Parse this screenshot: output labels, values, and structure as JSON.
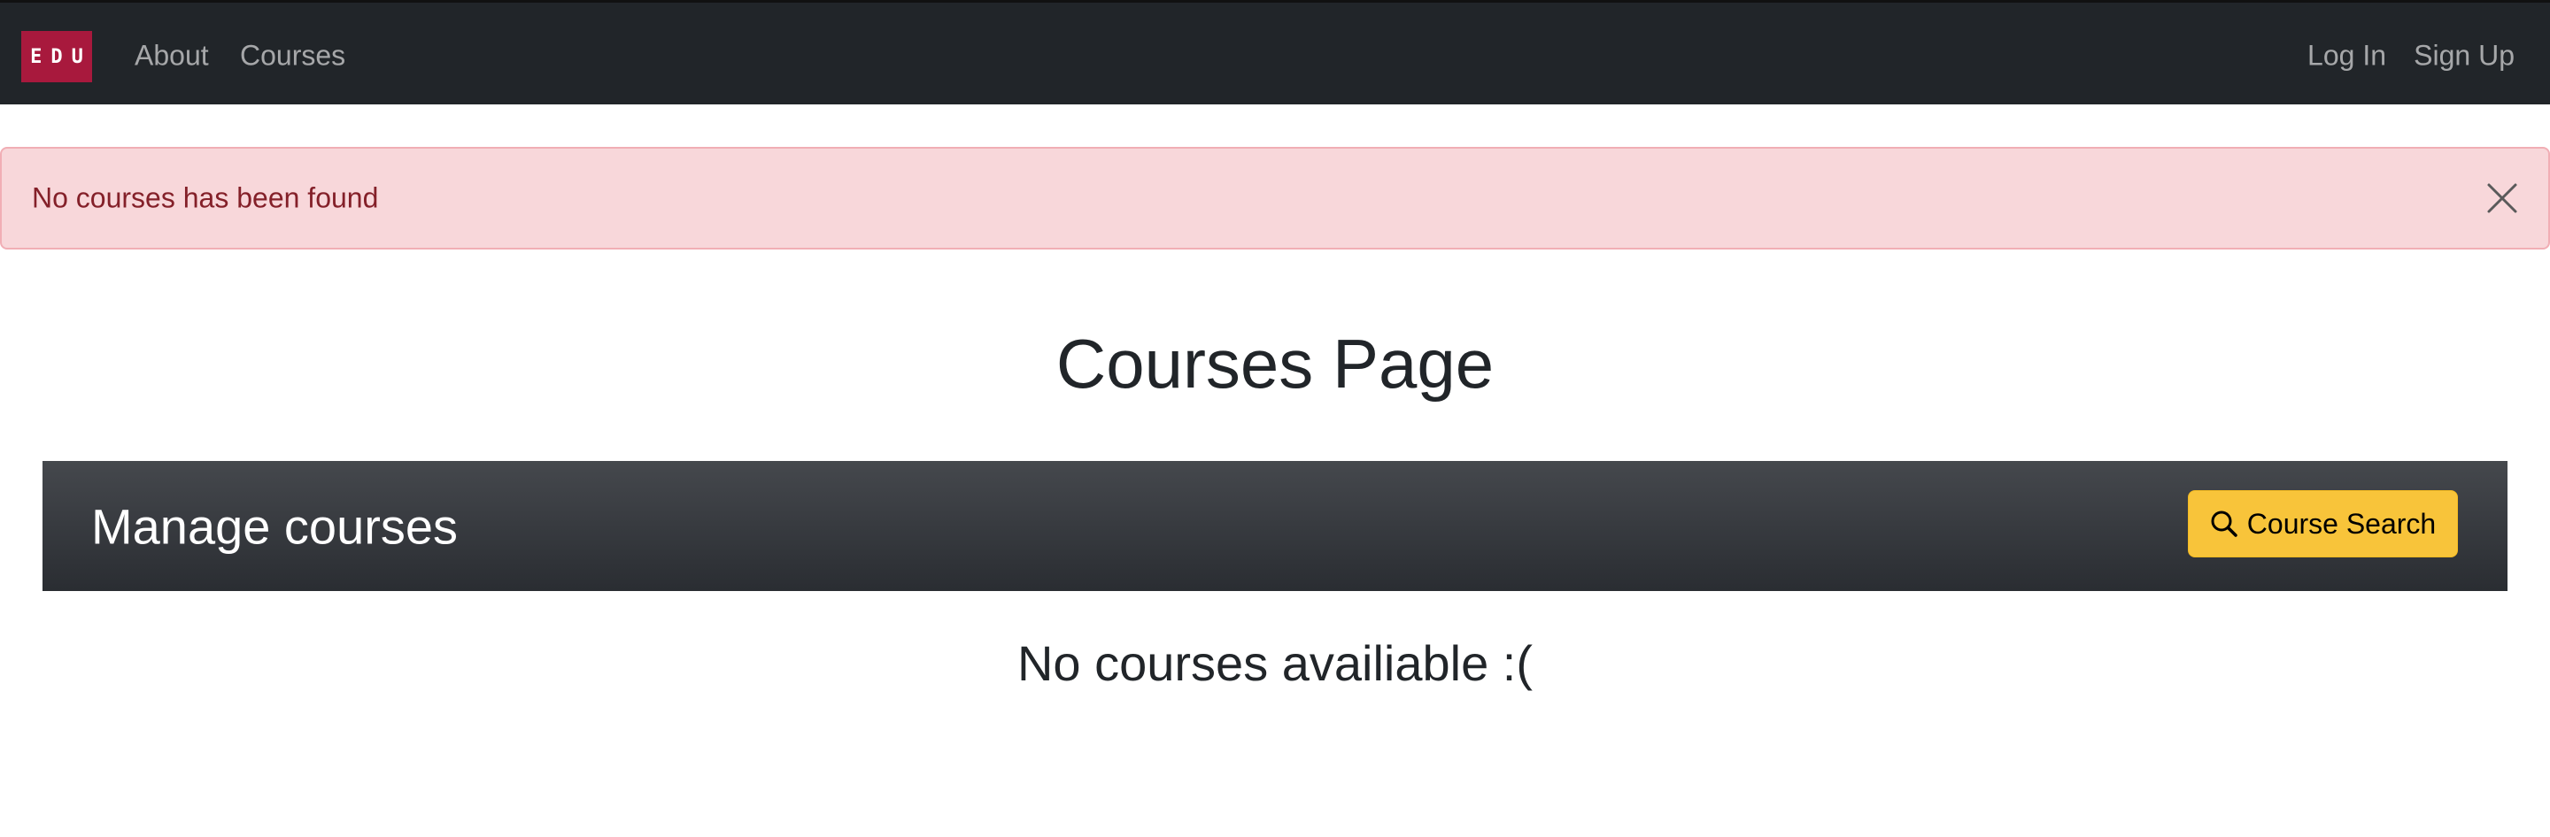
{
  "navbar": {
    "brand": "EDU",
    "links": [
      {
        "label": "About"
      },
      {
        "label": "Courses"
      }
    ],
    "auth": {
      "login_label": "Log In",
      "signup_label": "Sign Up"
    }
  },
  "alert": {
    "message": "No courses has been found",
    "close_icon": "close-icon"
  },
  "page": {
    "title": "Courses Page"
  },
  "manage": {
    "title": "Manage courses",
    "search_button_label": "Course Search",
    "search_icon": "search-icon"
  },
  "empty_state": {
    "message": "No courses availiable :("
  },
  "colors": {
    "navbar_bg": "#212529",
    "brand_bg": "#a8193d",
    "alert_bg": "#f8d7da",
    "alert_text": "#842029",
    "search_button_bg": "#f8c43a"
  }
}
